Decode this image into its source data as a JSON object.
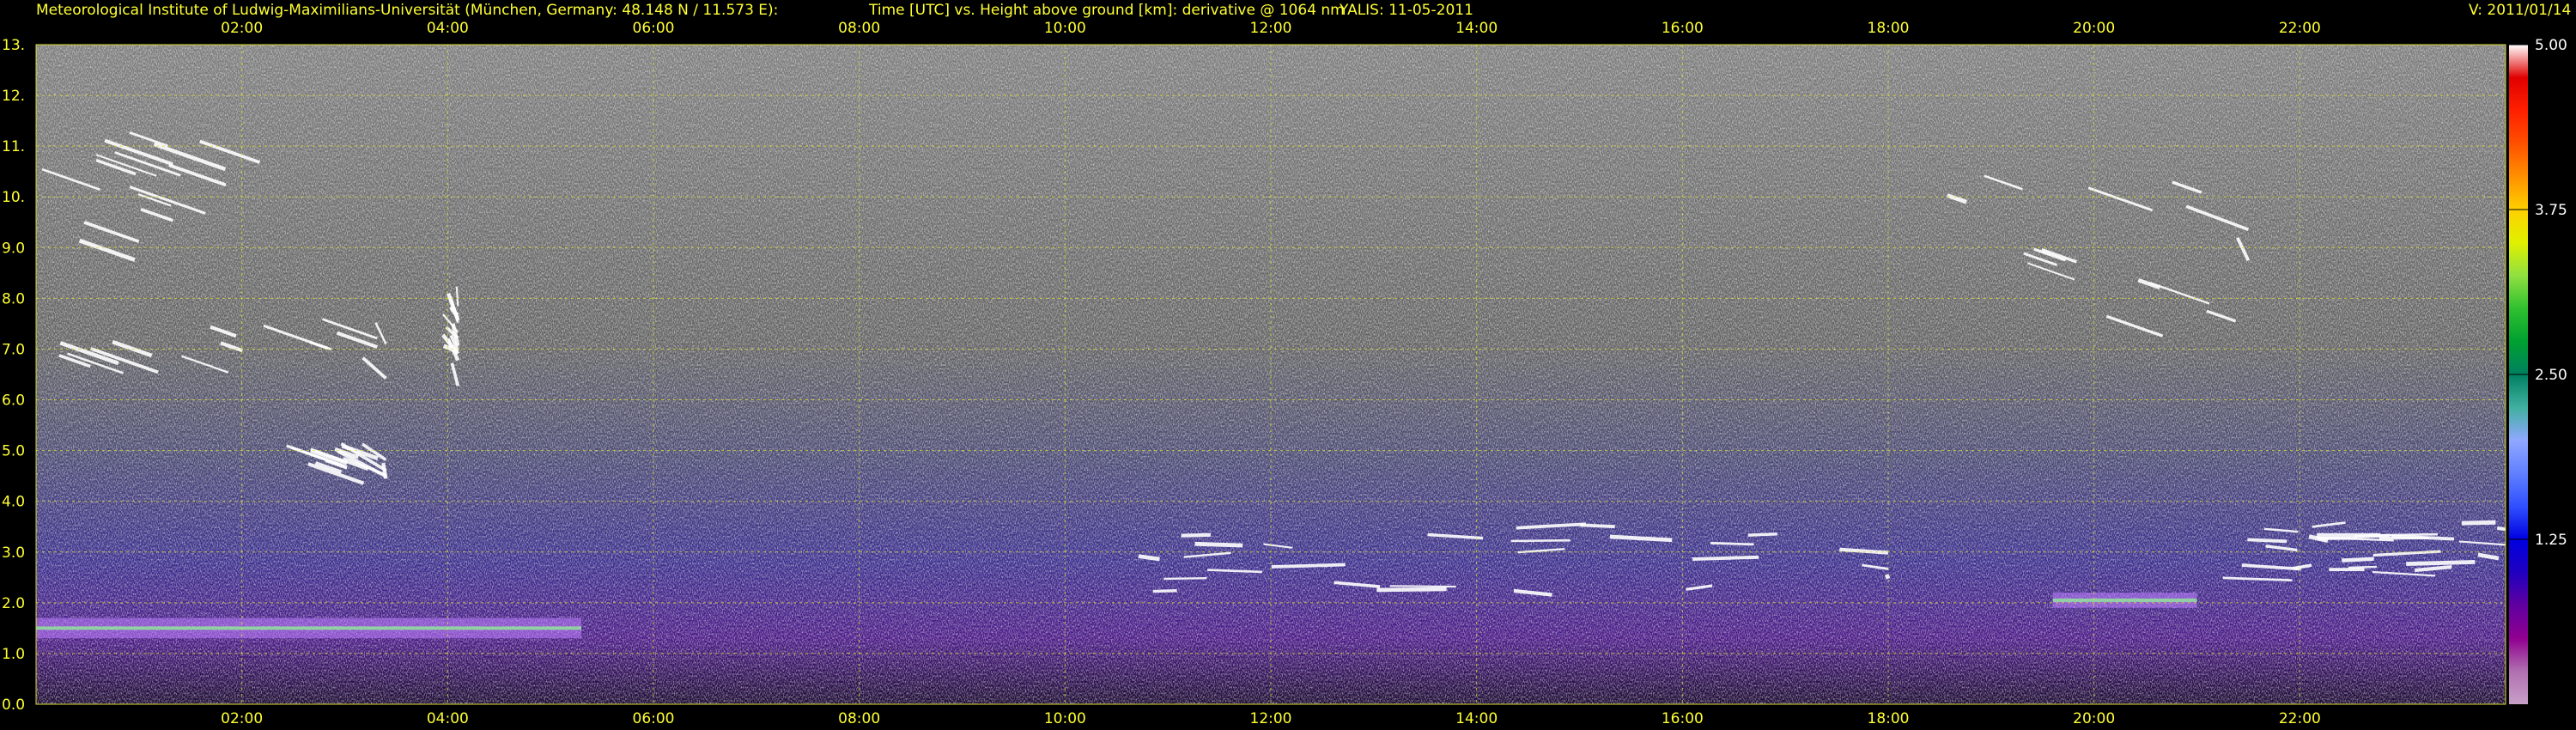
{
  "header": {
    "institute": "Meteorological Institute of Ludwig-Maximilians-Universität (München, Germany: 48.148 N / 11.573 E):",
    "title": "Time [UTC] vs. Height above ground [km]: derivative @ 1064 nm",
    "station_date": "YALIS: 11-05-2011",
    "version": "V: 2011/01/14"
  },
  "chart_data": {
    "type": "heatmap",
    "title": "Time [UTC] vs. Height above ground [km]: derivative @ 1064 nm",
    "xlabel": "Time [UTC]",
    "ylabel": "Height above ground [km]",
    "xlim": [
      0,
      24
    ],
    "ylim": [
      0,
      13
    ],
    "x_ticks": [
      2,
      4,
      6,
      8,
      10,
      12,
      14,
      16,
      18,
      20,
      22
    ],
    "x_tick_labels": [
      "02:00",
      "04:00",
      "06:00",
      "08:00",
      "10:00",
      "12:00",
      "14:00",
      "16:00",
      "18:00",
      "20:00",
      "22:00"
    ],
    "y_ticks": [
      0,
      1,
      2,
      3,
      4,
      5,
      6,
      7,
      8,
      9,
      10,
      11,
      12,
      13
    ],
    "y_tick_labels": [
      "0.0",
      "1.0",
      "2.0",
      "3.0",
      "4.0",
      "5.0",
      "6.0",
      "7.0",
      "8.0",
      "9.0",
      "10.",
      "11.",
      "12.",
      "13."
    ],
    "grid": true,
    "colorbar": {
      "min": 0,
      "max": 5,
      "tick_values": [
        1.25,
        2.5,
        3.75,
        5
      ],
      "tick_labels": [
        "1.25",
        "2.50",
        "3.75",
        "5.00"
      ],
      "colors": [
        "#c8a0c8",
        "#b070b0",
        "#900090",
        "#6000a0",
        "#2000c0",
        "#0000e0",
        "#3050ff",
        "#6080ff",
        "#90a8ff",
        "#40b0a0",
        "#008060",
        "#00a030",
        "#30c030",
        "#90e040",
        "#e0f000",
        "#ffd000",
        "#ff9000",
        "#ff5000",
        "#ff2000",
        "#e00000",
        "#ffffff"
      ]
    },
    "features": [
      {
        "type": "cirrus",
        "t_start": 0.0,
        "t_end": 2.2,
        "h_low": 9.0,
        "h_high": 11.3
      },
      {
        "type": "cirrus",
        "t_start": 0.0,
        "t_end": 3.4,
        "h_low": 6.8,
        "h_high": 7.6
      },
      {
        "type": "cirrus",
        "t_start": 2.4,
        "t_end": 3.4,
        "h_low": 4.7,
        "h_high": 5.2
      },
      {
        "type": "cirrus",
        "t_start": 3.9,
        "t_end": 4.1,
        "h_low": 6.0,
        "h_high": 8.5
      },
      {
        "type": "cirrus",
        "t_start": 18.5,
        "t_end": 21.5,
        "h_low": 7.4,
        "h_high": 10.6
      },
      {
        "type": "aerosol_layer",
        "t_start": 0.0,
        "t_end": 5.3,
        "h_low": 1.3,
        "h_high": 1.7
      },
      {
        "type": "aerosol_layer",
        "t_start": 19.6,
        "t_end": 21.0,
        "h_low": 1.9,
        "h_high": 2.2
      },
      {
        "type": "cloud_top",
        "t_start": 9.6,
        "t_end": 18.0,
        "h_low": 2.2,
        "h_high": 3.6
      },
      {
        "type": "cloud_top",
        "t_start": 21.2,
        "t_end": 24.0,
        "h_low": 2.4,
        "h_high": 3.7
      }
    ]
  }
}
